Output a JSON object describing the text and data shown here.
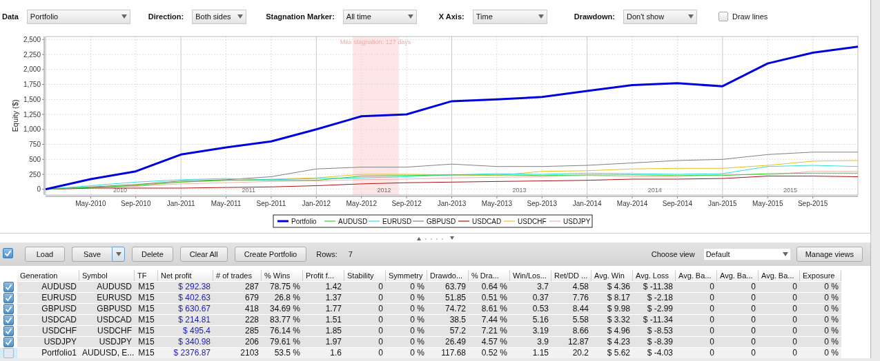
{
  "toolbar": {
    "fields": [
      {
        "label": "Data",
        "value": "Portfolio"
      },
      {
        "label": "Direction:",
        "value": "Both sides"
      },
      {
        "label": "Stagnation Marker:",
        "value": "All time"
      },
      {
        "label": "X Axis:",
        "value": "Time"
      },
      {
        "label": "Drawdown:",
        "value": "Don't show"
      }
    ],
    "draw_lines": {
      "label": "Draw lines",
      "checked": false
    }
  },
  "chart": {
    "chart_data": {
      "type": "line",
      "ylabel": "Equity ($)",
      "ylim": [
        -95,
        2550
      ],
      "categories": [
        null,
        "May-2010",
        "Sep-2010",
        "Jan-2011",
        "May-2011",
        "Sep-2011",
        "Jan-2012",
        "May-2012",
        "Sep-2012",
        "Jan-2013",
        "May-2013",
        "Sep-2013",
        "Jan-2014",
        "May-2014",
        "Sep-2014",
        "Jan-2015",
        "May-2015",
        "Sep-2015",
        null
      ],
      "yticks": [
        {
          "value": 0,
          "label": "0"
        },
        {
          "value": 250,
          "label": "250"
        },
        {
          "value": 500,
          "label": "500"
        },
        {
          "value": 750,
          "label": "750"
        },
        {
          "value": 1000,
          "label": "1,000"
        },
        {
          "value": 1250,
          "label": "1,250"
        },
        {
          "value": 1500,
          "label": "1,500"
        },
        {
          "value": 1750,
          "label": "1,750"
        },
        {
          "value": 2000,
          "label": "2,000"
        },
        {
          "value": 2250,
          "label": "2,250"
        },
        {
          "value": 2500,
          "label": "2,500"
        }
      ],
      "series": [
        {
          "name": "Portfolio",
          "color": "#0000dd",
          "values": [
            0,
            170,
            300,
            580,
            700,
            800,
            1000,
            1220,
            1250,
            1470,
            1500,
            1540,
            1640,
            1740,
            1770,
            1720,
            2100,
            2280,
            2380
          ]
        },
        {
          "name": "AUDUSD",
          "color": "#33cc33",
          "values": [
            0,
            30,
            60,
            120,
            150,
            150,
            150,
            220,
            230,
            240,
            240,
            230,
            240,
            240,
            230,
            230,
            260,
            270,
            270
          ]
        },
        {
          "name": "EURUSD",
          "color": "#33dddd",
          "values": [
            0,
            60,
            120,
            160,
            180,
            160,
            180,
            190,
            210,
            240,
            260,
            250,
            270,
            260,
            250,
            260,
            380,
            400,
            380
          ]
        },
        {
          "name": "GBPUSD",
          "color": "#808080",
          "values": [
            0,
            40,
            80,
            140,
            160,
            210,
            340,
            370,
            370,
            420,
            380,
            380,
            400,
            440,
            480,
            500,
            580,
            620,
            620
          ]
        },
        {
          "name": "USDCAD",
          "color": "#aa1111",
          "values": [
            0,
            20,
            20,
            20,
            30,
            40,
            60,
            90,
            110,
            120,
            130,
            140,
            150,
            170,
            170,
            180,
            220,
            220,
            210
          ]
        },
        {
          "name": "USDCHF",
          "color": "#e6c020",
          "values": [
            0,
            20,
            70,
            120,
            150,
            170,
            190,
            250,
            250,
            240,
            230,
            300,
            310,
            340,
            350,
            350,
            400,
            470,
            480
          ]
        },
        {
          "name": "USDJPY",
          "color": "#f0b0b0",
          "values": [
            0,
            30,
            50,
            90,
            110,
            130,
            140,
            160,
            170,
            190,
            200,
            210,
            230,
            210,
            210,
            250,
            240,
            300,
            300
          ]
        }
      ],
      "grid": true,
      "legend": "bottom",
      "annotations": [
        "2010",
        "2011",
        "2012",
        "2013",
        "2014",
        "2015"
      ]
    },
    "stagnation_label": "Max stagnation: 127 days"
  },
  "actions": {
    "select_all": {
      "checked": true
    },
    "buttons": [
      {
        "label": "Load",
        "kind": "plain"
      },
      {
        "label": "Save",
        "kind": "split"
      },
      {
        "label": "Delete",
        "kind": "plain"
      },
      {
        "label": "Clear All",
        "kind": "plain"
      },
      {
        "label": "Create Portfolio",
        "kind": "plain"
      }
    ],
    "rows_label": "Rows:",
    "rows_count": "7",
    "choose_view": {
      "label": "Choose view",
      "value": "Default"
    },
    "manage_views": "Manage views"
  },
  "table": {
    "columns": [
      "Generation",
      "Symbol",
      "TF",
      "Net profit",
      "# of trades",
      "% Wins",
      "Profit f...",
      "Stability",
      "Symmetry",
      "Drawdo...",
      "% Dra...",
      "Win/Los...",
      "Ret/DD ...",
      "Avg. Win",
      "Avg. Loss",
      "Avg. Ba...",
      "Avg. Ba...",
      "Avg. Ba...",
      "Exposure"
    ],
    "rows": [
      {
        "checked": true,
        "selected": false,
        "cells": [
          "AUDUSD",
          "AUDUSD",
          "M15",
          "$ 292.38",
          "287",
          "78.75 %",
          "1.42",
          "0",
          "0 %",
          "63.79",
          "0.64 %",
          "3.7",
          "4.58",
          "$ 4.36",
          "$ -11.38",
          "0",
          "0",
          "0",
          "0 %"
        ]
      },
      {
        "checked": true,
        "selected": false,
        "cells": [
          "EURUSD",
          "EURUSD",
          "M15",
          "$ 402.63",
          "679",
          "26.8 %",
          "1.37",
          "0",
          "0 %",
          "51.85",
          "0.51 %",
          "0.37",
          "7.76",
          "$ 8.17",
          "$ -2.18",
          "0",
          "0",
          "0",
          "0 %"
        ]
      },
      {
        "checked": true,
        "selected": false,
        "cells": [
          "GBPUSD",
          "GBPUSD",
          "M15",
          "$ 630.67",
          "418",
          "34.69 %",
          "1.77",
          "0",
          "0 %",
          "74.72",
          "8.61 %",
          "0.53",
          "8.44",
          "$ 9.98",
          "$ -2.99",
          "0",
          "0",
          "0",
          "0 %"
        ]
      },
      {
        "checked": true,
        "selected": false,
        "cells": [
          "USDCAD",
          "USDCAD",
          "M15",
          "$ 214.81",
          "228",
          "83.77 %",
          "1.51",
          "0",
          "0 %",
          "38.5",
          "7.44 %",
          "5.16",
          "5.58",
          "$ 3.32",
          "$ -11.34",
          "0",
          "0",
          "0",
          "0 %"
        ]
      },
      {
        "checked": true,
        "selected": false,
        "cells": [
          "USDCHF",
          "USDCHF",
          "M15",
          "$ 495.4",
          "285",
          "76.14 %",
          "1.85",
          "0",
          "0 %",
          "57.2",
          "7.21 %",
          "3.19",
          "8.66",
          "$ 4.96",
          "$ -8.53",
          "0",
          "0",
          "0",
          "0 %"
        ]
      },
      {
        "checked": true,
        "selected": false,
        "cells": [
          "USDJPY",
          "USDJPY",
          "M15",
          "$ 340.98",
          "206",
          "79.61 %",
          "1.97",
          "0",
          "0 %",
          "26.49",
          "4.57 %",
          "3.9",
          "12.87",
          "$ 4.23",
          "$ -8.39",
          "0",
          "0",
          "0",
          "0 %"
        ]
      },
      {
        "checked": false,
        "selected": true,
        "cells": [
          "Portfolio1",
          "AUDUSD, E...",
          "M15",
          "$ 2376.87",
          "2103",
          "53.5 %",
          "1.6",
          "0",
          "0 %",
          "117.68",
          "0.52 %",
          "1.15",
          "20.2",
          "$ 5.62",
          "$ -4.03",
          "0",
          "0",
          "0",
          "0 %"
        ]
      }
    ]
  }
}
